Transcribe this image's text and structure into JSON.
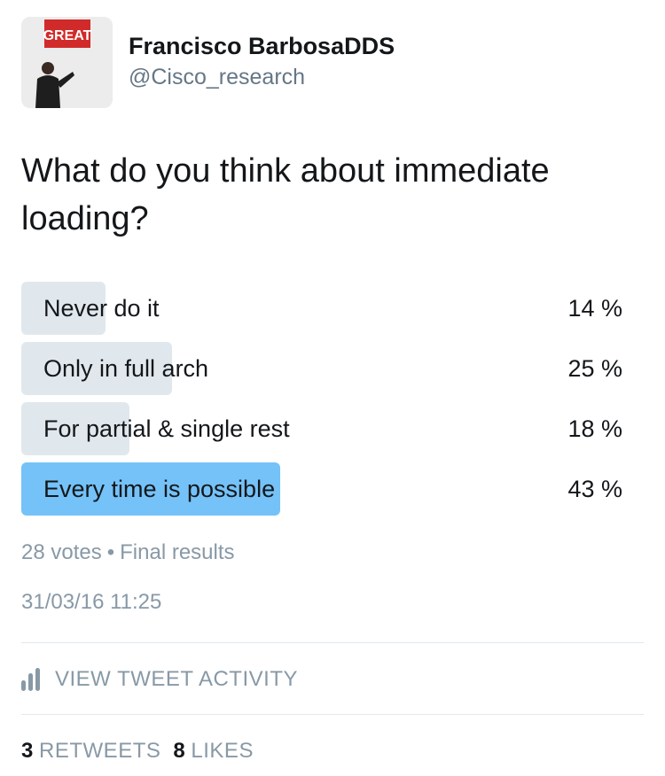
{
  "author": {
    "display_name": "Francisco BarbosaDDS",
    "handle": "@Cisco_research",
    "avatar_sign_text": "GREAT"
  },
  "tweet": {
    "question": "What do you think about immediate loading?",
    "poll": {
      "choices": [
        {
          "label": "Never do it",
          "percent": 14,
          "percent_label": "14 %"
        },
        {
          "label": "Only in full arch",
          "percent": 25,
          "percent_label": "25 %"
        },
        {
          "label": "For partial & single rest",
          "percent": 18,
          "percent_label": "18 %"
        },
        {
          "label": "Every time is possible",
          "percent": 43,
          "percent_label": "43 %",
          "winner": true
        }
      ],
      "votes": "28 votes",
      "separator": "•",
      "status": "Final results"
    },
    "timestamp": "31/03/16 11:25"
  },
  "activity": {
    "label": "VIEW TWEET ACTIVITY",
    "icon": "bar-chart-icon"
  },
  "stats": {
    "retweets_count": "3",
    "retweets_label": "RETWEETS",
    "likes_count": "8",
    "likes_label": "LIKES"
  },
  "colors": {
    "text": "#14171a",
    "secondary": "#8899a6",
    "bar": "#e1e8ed",
    "winner_bar": "#74c2f8",
    "divider": "#e1e8ed"
  }
}
